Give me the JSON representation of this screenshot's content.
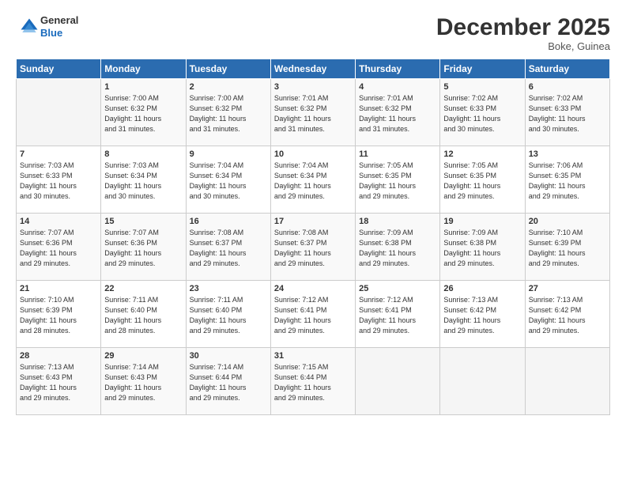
{
  "header": {
    "logo_general": "General",
    "logo_blue": "Blue",
    "title": "December 2025",
    "location": "Boke, Guinea"
  },
  "days_of_week": [
    "Sunday",
    "Monday",
    "Tuesday",
    "Wednesday",
    "Thursday",
    "Friday",
    "Saturday"
  ],
  "weeks": [
    [
      {
        "day": "",
        "info": ""
      },
      {
        "day": "1",
        "info": "Sunrise: 7:00 AM\nSunset: 6:32 PM\nDaylight: 11 hours\nand 31 minutes."
      },
      {
        "day": "2",
        "info": "Sunrise: 7:00 AM\nSunset: 6:32 PM\nDaylight: 11 hours\nand 31 minutes."
      },
      {
        "day": "3",
        "info": "Sunrise: 7:01 AM\nSunset: 6:32 PM\nDaylight: 11 hours\nand 31 minutes."
      },
      {
        "day": "4",
        "info": "Sunrise: 7:01 AM\nSunset: 6:32 PM\nDaylight: 11 hours\nand 31 minutes."
      },
      {
        "day": "5",
        "info": "Sunrise: 7:02 AM\nSunset: 6:33 PM\nDaylight: 11 hours\nand 30 minutes."
      },
      {
        "day": "6",
        "info": "Sunrise: 7:02 AM\nSunset: 6:33 PM\nDaylight: 11 hours\nand 30 minutes."
      }
    ],
    [
      {
        "day": "7",
        "info": "Sunrise: 7:03 AM\nSunset: 6:33 PM\nDaylight: 11 hours\nand 30 minutes."
      },
      {
        "day": "8",
        "info": "Sunrise: 7:03 AM\nSunset: 6:34 PM\nDaylight: 11 hours\nand 30 minutes."
      },
      {
        "day": "9",
        "info": "Sunrise: 7:04 AM\nSunset: 6:34 PM\nDaylight: 11 hours\nand 30 minutes."
      },
      {
        "day": "10",
        "info": "Sunrise: 7:04 AM\nSunset: 6:34 PM\nDaylight: 11 hours\nand 29 minutes."
      },
      {
        "day": "11",
        "info": "Sunrise: 7:05 AM\nSunset: 6:35 PM\nDaylight: 11 hours\nand 29 minutes."
      },
      {
        "day": "12",
        "info": "Sunrise: 7:05 AM\nSunset: 6:35 PM\nDaylight: 11 hours\nand 29 minutes."
      },
      {
        "day": "13",
        "info": "Sunrise: 7:06 AM\nSunset: 6:35 PM\nDaylight: 11 hours\nand 29 minutes."
      }
    ],
    [
      {
        "day": "14",
        "info": "Sunrise: 7:07 AM\nSunset: 6:36 PM\nDaylight: 11 hours\nand 29 minutes."
      },
      {
        "day": "15",
        "info": "Sunrise: 7:07 AM\nSunset: 6:36 PM\nDaylight: 11 hours\nand 29 minutes."
      },
      {
        "day": "16",
        "info": "Sunrise: 7:08 AM\nSunset: 6:37 PM\nDaylight: 11 hours\nand 29 minutes."
      },
      {
        "day": "17",
        "info": "Sunrise: 7:08 AM\nSunset: 6:37 PM\nDaylight: 11 hours\nand 29 minutes."
      },
      {
        "day": "18",
        "info": "Sunrise: 7:09 AM\nSunset: 6:38 PM\nDaylight: 11 hours\nand 29 minutes."
      },
      {
        "day": "19",
        "info": "Sunrise: 7:09 AM\nSunset: 6:38 PM\nDaylight: 11 hours\nand 29 minutes."
      },
      {
        "day": "20",
        "info": "Sunrise: 7:10 AM\nSunset: 6:39 PM\nDaylight: 11 hours\nand 29 minutes."
      }
    ],
    [
      {
        "day": "21",
        "info": "Sunrise: 7:10 AM\nSunset: 6:39 PM\nDaylight: 11 hours\nand 28 minutes."
      },
      {
        "day": "22",
        "info": "Sunrise: 7:11 AM\nSunset: 6:40 PM\nDaylight: 11 hours\nand 28 minutes."
      },
      {
        "day": "23",
        "info": "Sunrise: 7:11 AM\nSunset: 6:40 PM\nDaylight: 11 hours\nand 29 minutes."
      },
      {
        "day": "24",
        "info": "Sunrise: 7:12 AM\nSunset: 6:41 PM\nDaylight: 11 hours\nand 29 minutes."
      },
      {
        "day": "25",
        "info": "Sunrise: 7:12 AM\nSunset: 6:41 PM\nDaylight: 11 hours\nand 29 minutes."
      },
      {
        "day": "26",
        "info": "Sunrise: 7:13 AM\nSunset: 6:42 PM\nDaylight: 11 hours\nand 29 minutes."
      },
      {
        "day": "27",
        "info": "Sunrise: 7:13 AM\nSunset: 6:42 PM\nDaylight: 11 hours\nand 29 minutes."
      }
    ],
    [
      {
        "day": "28",
        "info": "Sunrise: 7:13 AM\nSunset: 6:43 PM\nDaylight: 11 hours\nand 29 minutes."
      },
      {
        "day": "29",
        "info": "Sunrise: 7:14 AM\nSunset: 6:43 PM\nDaylight: 11 hours\nand 29 minutes."
      },
      {
        "day": "30",
        "info": "Sunrise: 7:14 AM\nSunset: 6:44 PM\nDaylight: 11 hours\nand 29 minutes."
      },
      {
        "day": "31",
        "info": "Sunrise: 7:15 AM\nSunset: 6:44 PM\nDaylight: 11 hours\nand 29 minutes."
      },
      {
        "day": "",
        "info": ""
      },
      {
        "day": "",
        "info": ""
      },
      {
        "day": "",
        "info": ""
      }
    ]
  ]
}
